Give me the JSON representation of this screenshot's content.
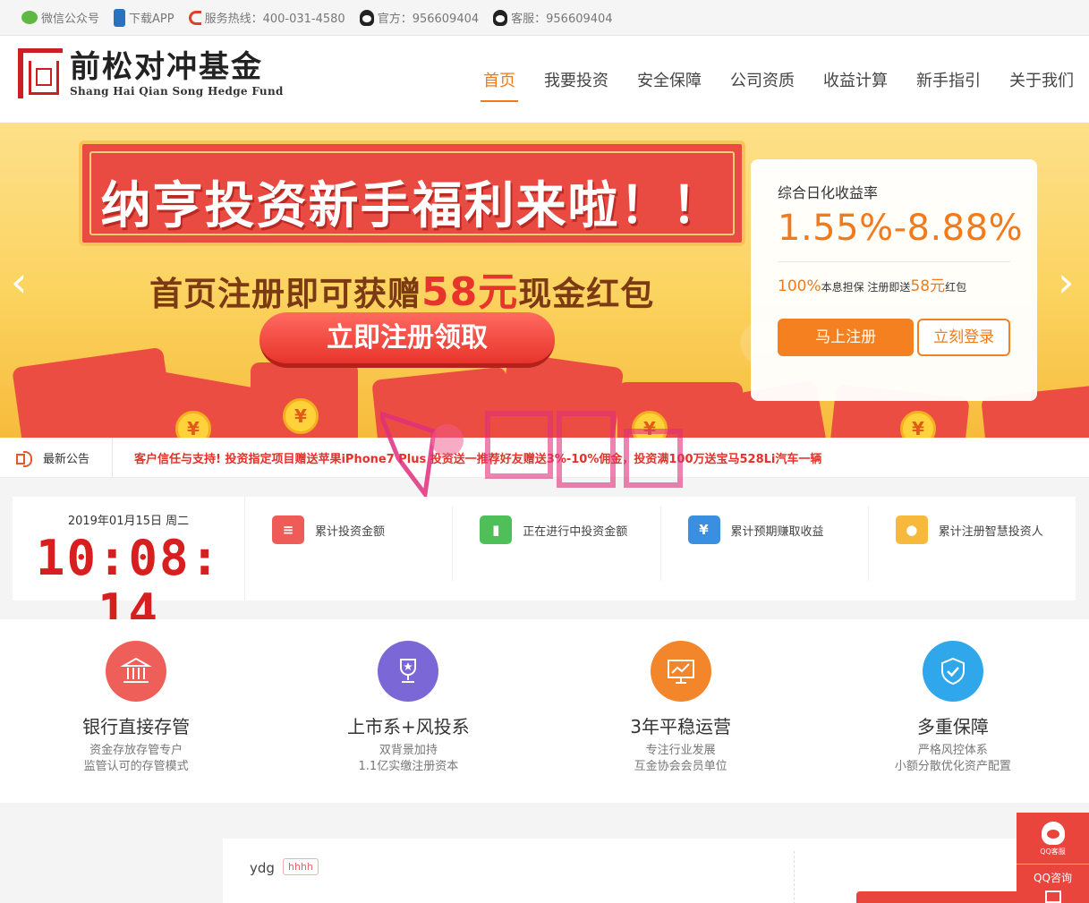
{
  "topbar": {
    "wechat": "微信公众号",
    "app": "下载APP",
    "hotline": "服务热线：400-031-4580",
    "official": "官方：956609404",
    "service": "客服：956609404"
  },
  "logo": {
    "cn": "前松对冲基金",
    "en": "Shang Hai Qian Song Hedge Fund"
  },
  "nav": {
    "items": [
      "首页",
      "我要投资",
      "安全保障",
      "公司资质",
      "收益计算",
      "新手指引",
      "关于我们"
    ]
  },
  "banner": {
    "title": "纳亨投资新手福利来啦！！",
    "sub_before": "首页注册即可获赠",
    "sub_highlight": "58元",
    "sub_after": "现金红包",
    "button": "立即注册领取",
    "coin_symbol": "¥",
    "arrow_left": "‹",
    "arrow_right": "›"
  },
  "rate_card": {
    "label": "综合日化收益率",
    "value": "1.55%-8.88%",
    "note_pct": "100%",
    "note_mid": "本息担保 注册即送",
    "note_amount": "58元",
    "note_end": "红包",
    "register": "马上注册",
    "login": "立刻登录"
  },
  "notice": {
    "label": "最新公告",
    "text": "客户信任与支持!    投资指定项目赠送苹果iPhone7 Plus    投资送一推荐好友赠送3%-10%佣金，投资满100万送宝马528Li汽车一辆"
  },
  "clock": {
    "date": "2019年01月15日 周二",
    "time": "10:08: 14"
  },
  "stats": [
    {
      "label": "累计投资金额",
      "icon": "stack-icon",
      "color": "#ef5b57"
    },
    {
      "label": "正在进行中投资金额",
      "icon": "bar-chart-icon",
      "color": "#4fbf5a"
    },
    {
      "label": "累计预期赚取收益",
      "icon": "yen-icon",
      "color": "#3b8fe0"
    },
    {
      "label": "累计注册智慧投资人",
      "icon": "user-icon",
      "color": "#f6b93b"
    }
  ],
  "features": [
    {
      "title": "银行直接存管",
      "line1": "资金存放存管专户",
      "line2": "监管认可的存管模式",
      "color": "#ef5f5a",
      "icon": "bank-icon"
    },
    {
      "title": "上市系+风投系",
      "line1": "双背景加持",
      "line2": "1.1亿实缴注册资本",
      "color": "#7b68d6",
      "icon": "trophy-icon"
    },
    {
      "title": "3年平稳运营",
      "line1": "专注行业发展",
      "line2": "互金协会会员单位",
      "color": "#f3862a",
      "icon": "chart-screen-icon"
    },
    {
      "title": "多重保障",
      "line1": "严格风控体系",
      "line2": "小额分散优化资产配置",
      "color": "#2fa7ea",
      "icon": "shield-check-icon"
    }
  ],
  "bottom": {
    "name": "ydg",
    "tag": "hhhh"
  },
  "qq_float": {
    "small": "QQ客服",
    "label": "QQ咨询"
  },
  "colors": {
    "accent": "#f27a1a",
    "red": "#e5312a"
  }
}
